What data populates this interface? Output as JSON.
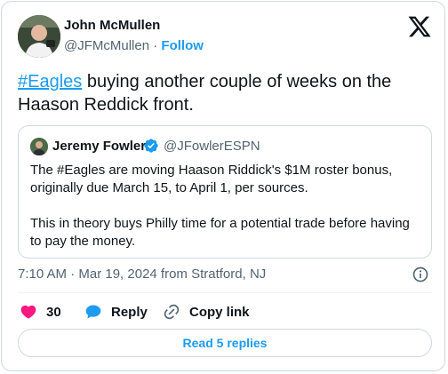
{
  "author": {
    "name": "John McMullen",
    "handle": "@JFMcMullen",
    "separator": "·",
    "follow_label": "Follow"
  },
  "tweet": {
    "hashtag": "#Eagles",
    "text_rest": " buying another couple of weeks on the Haason Reddick front."
  },
  "quote": {
    "name": "Jeremy Fowler",
    "handle": "@JFowlerESPN",
    "paragraph1": "The #Eagles are moving Haason Riddick's $1M roster bonus, originally due March 15, to April 1, per sources.",
    "paragraph2": "This in theory buys Philly time for a potential trade before having to pay the money."
  },
  "timestamp": "7:10 AM · Mar 19, 2024 from Stratford, NJ",
  "actions": {
    "like_count": "30",
    "reply_label": "Reply",
    "copy_label": "Copy link"
  },
  "read_replies_label": "Read 5 replies",
  "colors": {
    "accent": "#1d9bf0",
    "like": "#f91880",
    "text_secondary": "#536471",
    "border": "#cfd9de"
  },
  "icons": [
    "x-logo-icon",
    "verified-badge-icon",
    "info-icon",
    "heart-icon",
    "reply-bubble-icon",
    "link-icon"
  ]
}
